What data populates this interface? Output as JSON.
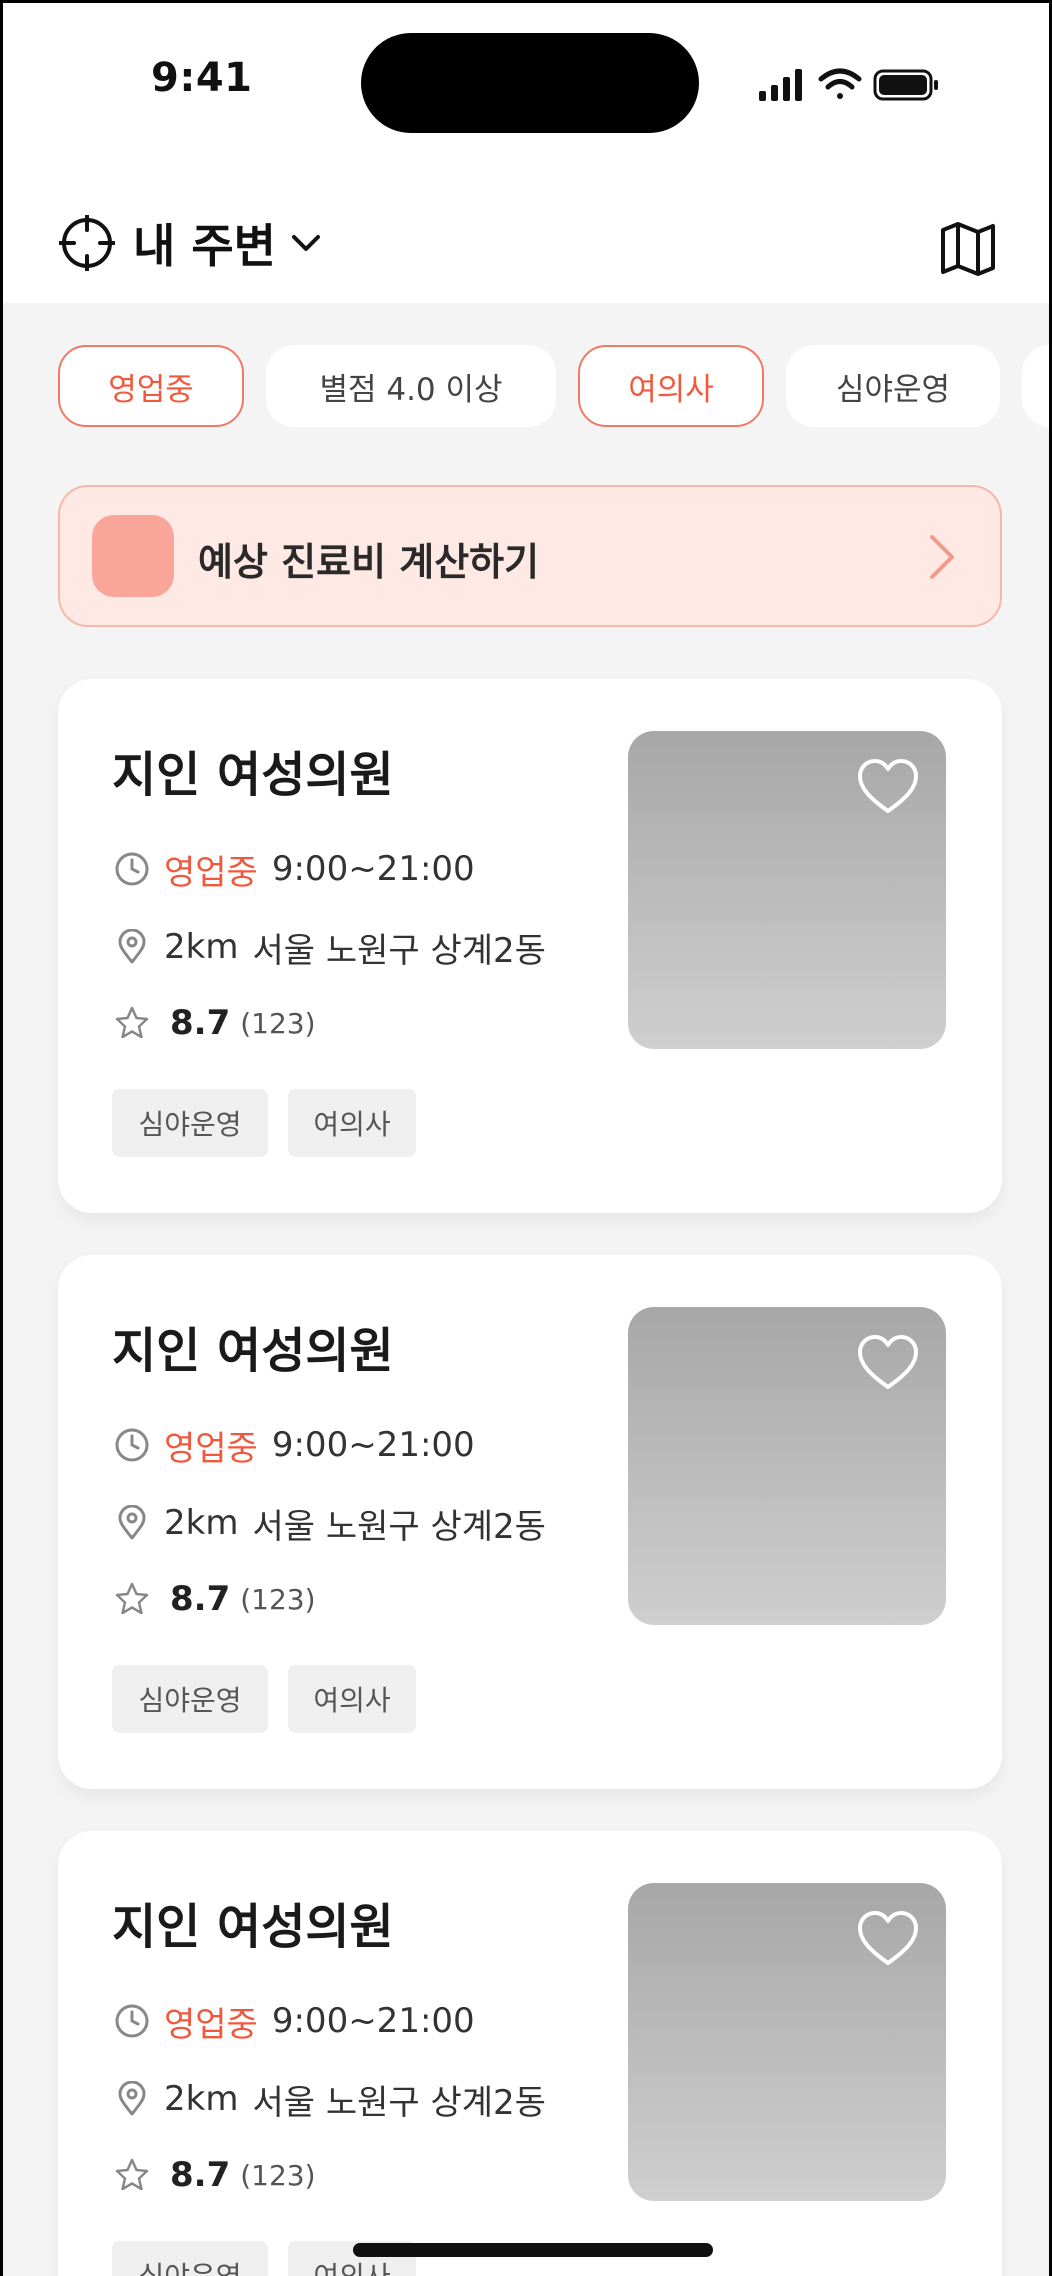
{
  "status_bar": {
    "time": "9:41"
  },
  "header": {
    "location_label": "내 주변"
  },
  "filters": [
    {
      "label": "영업중",
      "active": true
    },
    {
      "label": "별점 4.0 이상",
      "active": false
    },
    {
      "label": "여의사",
      "active": true
    },
    {
      "label": "심야운영",
      "active": false
    },
    {
      "label": "",
      "active": false
    }
  ],
  "banner": {
    "label": "예상 진료비 계산하기"
  },
  "clinics": [
    {
      "name": "지인 여성의원",
      "open_status": "영업중",
      "hours": "9:00~21:00",
      "distance": "2km",
      "address": "서울 노원구 상계2동",
      "rating": "8.7",
      "review_count": "(123)",
      "tags": [
        "심야운영",
        "여의사"
      ]
    },
    {
      "name": "지인 여성의원",
      "open_status": "영업중",
      "hours": "9:00~21:00",
      "distance": "2km",
      "address": "서울 노원구 상계2동",
      "rating": "8.7",
      "review_count": "(123)",
      "tags": [
        "심야운영",
        "여의사"
      ]
    },
    {
      "name": "지인 여성의원",
      "open_status": "영업중",
      "hours": "9:00~21:00",
      "distance": "2km",
      "address": "서울 노원구 상계2동",
      "rating": "8.7",
      "review_count": "(123)",
      "tags": [
        "심야운영",
        "여의사"
      ]
    }
  ],
  "colors": {
    "accent": "#ef5a3e",
    "banner_bg": "#ffe9e4",
    "page_bg": "#f4f4f4"
  },
  "icons": {
    "location": "crosshair-icon",
    "dropdown": "chevron-down-icon",
    "map": "map-icon",
    "clock": "clock-icon",
    "pin": "map-pin-icon",
    "star": "star-icon",
    "heart": "heart-icon"
  }
}
